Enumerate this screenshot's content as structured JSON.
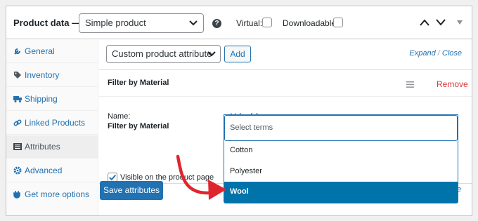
{
  "header": {
    "title": "Product data —",
    "product_type": "Simple product",
    "help_glyph": "?",
    "virtual_label": "Virtual:",
    "downloadable_label": "Downloadable:"
  },
  "sidebar": {
    "items": [
      {
        "label": "General",
        "icon": "wrench-icon"
      },
      {
        "label": "Inventory",
        "icon": "tag-icon"
      },
      {
        "label": "Shipping",
        "icon": "truck-icon"
      },
      {
        "label": "Linked Products",
        "icon": "link-icon"
      },
      {
        "label": "Attributes",
        "icon": "list-icon",
        "active": true
      },
      {
        "label": "Advanced",
        "icon": "gear-icon"
      },
      {
        "label": "Get more options",
        "icon": "plugin-icon"
      }
    ]
  },
  "toolbar": {
    "attribute_select": "Custom product attribute",
    "add_label": "Add",
    "expand_label": "Expand",
    "separator": "/",
    "close_label": "Close"
  },
  "attribute": {
    "title": "Filter by Material",
    "remove_label": "Remove",
    "name_label": "Name:",
    "name_value": "Filter by Material",
    "values_label": "Value(s):",
    "visible_label": "Visible on the product page",
    "visible_checked": true
  },
  "dropdown": {
    "placeholder": "Select terms",
    "options": [
      "Cotton",
      "Polyester",
      "Wool"
    ],
    "highlighted": "Wool"
  },
  "save_label": "Save attributes",
  "partial_link": "e",
  "colors": {
    "accent": "#2271b1",
    "highlight": "#0073aa",
    "remove": "#d63638",
    "annotation_arrow": "#e0262d"
  }
}
